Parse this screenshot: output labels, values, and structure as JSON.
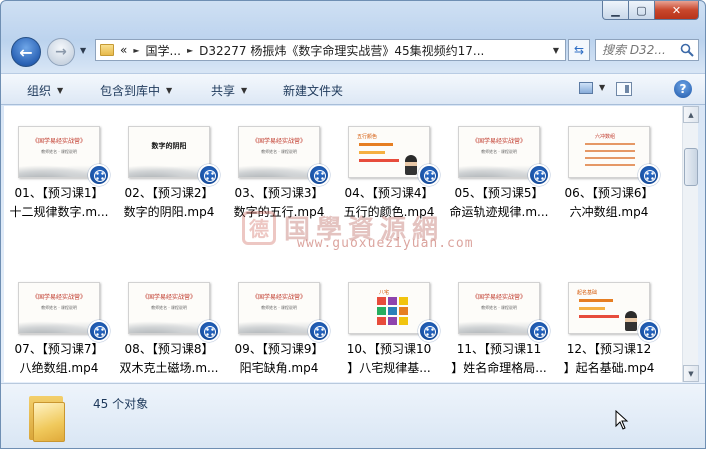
{
  "window": {
    "caption_min": "▁",
    "caption_max": "▢",
    "caption_close": "✕"
  },
  "address": {
    "prefix": "«",
    "segments": [
      "国学...",
      "D32277 杨振炜《数字命理实战营》45集视频约17..."
    ]
  },
  "search": {
    "placeholder": "搜索 D32...",
    "icon": "search-icon"
  },
  "toolbar": {
    "organize": "组织",
    "include_in_library": "包含到库中",
    "share": "共享",
    "new_folder": "新建文件夹",
    "help": "?"
  },
  "files": [
    {
      "line1": "01、【预习课1】",
      "line2": "十二规律数字.m...",
      "thumb": "title",
      "thumb_title": "《国学易经实战营》",
      "thumb_sub": "教师姓名 · 课程说明"
    },
    {
      "line1": "02、【预习课2】",
      "line2": "数字的阴阳.mp4",
      "thumb": "big",
      "thumb_title": "数字的阴阳",
      "thumb_sub": ""
    },
    {
      "line1": "03、【预习课3】",
      "line2": "数字的五行.mp4",
      "thumb": "title",
      "thumb_title": "《国学易经实战营》",
      "thumb_sub": "教师姓名 · 课程说明"
    },
    {
      "line1": "04、【预习课4】",
      "line2": "五行的颜色.mp4",
      "thumb": "chart",
      "thumb_title": "五行颜色",
      "thumb_sub": ""
    },
    {
      "line1": "05、【预习课5】",
      "line2": "命运轨迹规律.m...",
      "thumb": "title",
      "thumb_title": "《国学易经实战营》",
      "thumb_sub": "教师姓名 · 课程说明"
    },
    {
      "line1": "06、【预习课6】",
      "line2": "六冲数组.mp4",
      "thumb": "list",
      "thumb_title": "六冲数组",
      "thumb_sub": ""
    },
    {
      "line1": "07、【预习课7】",
      "line2": "八绝数组.mp4",
      "thumb": "title",
      "thumb_title": "《国学易经实战营》",
      "thumb_sub": "教师姓名 · 课程说明"
    },
    {
      "line1": "08、【预习课8】",
      "line2": "双木克土磁场.m...",
      "thumb": "title",
      "thumb_title": "《国学易经实战营》",
      "thumb_sub": "教师姓名 · 课程说明"
    },
    {
      "line1": "09、【预习课9】",
      "line2": "阳宅缺角.mp4",
      "thumb": "title",
      "thumb_title": "《国学易经实战营》",
      "thumb_sub": "教师姓名 · 课程说明"
    },
    {
      "line1": "10、【预习课10",
      "line2": "】八宅规律基...",
      "thumb": "grid",
      "thumb_title": "八宅",
      "thumb_sub": ""
    },
    {
      "line1": "11、【预习课11",
      "line2": "】姓名命理格局...",
      "thumb": "title",
      "thumb_title": "《国学易经实战营》",
      "thumb_sub": "教师姓名 · 课程说明"
    },
    {
      "line1": "12、【预习课12",
      "line2": "】起名基础.mp4",
      "thumb": "chart2",
      "thumb_title": "起名基础",
      "thumb_sub": ""
    }
  ],
  "watermark": {
    "seal": "德",
    "text": "国學資源網",
    "url": "www.guoxueziyuan.com"
  },
  "details": {
    "count": "45 个对象"
  },
  "colors": {
    "accent": "#2a62b5",
    "close": "#c9472c",
    "thumb_title": "#c0392b"
  }
}
